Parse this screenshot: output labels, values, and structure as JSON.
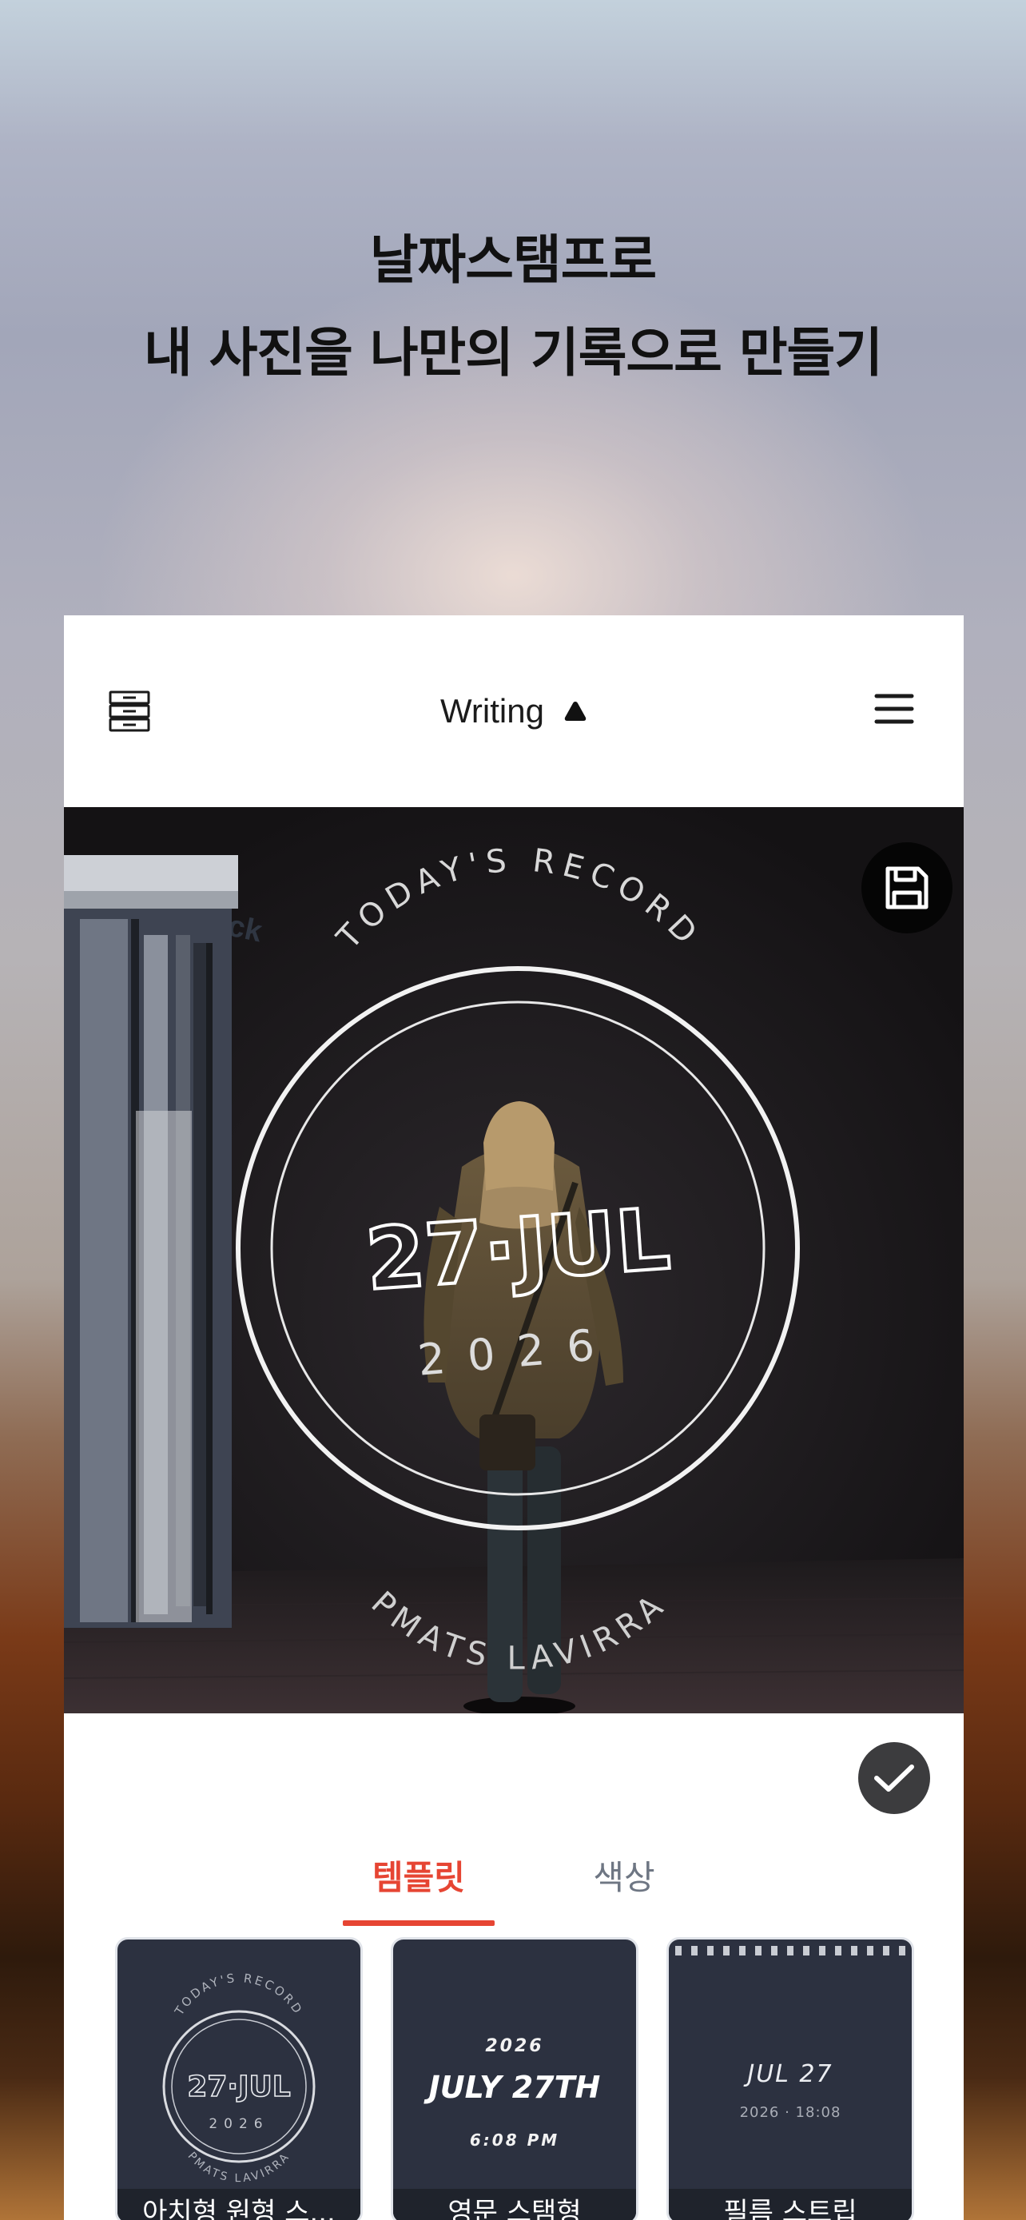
{
  "headline": {
    "line1": "날짜스탬프로",
    "line2": "내 사진을 나만의 기록으로 만들기"
  },
  "app_bar": {
    "left_icon": "drawer-stack-icon",
    "title": "Writing",
    "title_icon": "triangle-up-icon",
    "right_icon": "hamburger-menu-icon"
  },
  "photo": {
    "storefront_sign": "Neck",
    "stamp": {
      "top_text": "TODAY'S RECORD",
      "date": "27·JUL",
      "year": "2026",
      "bottom_text": "PMATS LAVIRRA"
    },
    "save_icon": "floppy-disk-icon"
  },
  "confirm_icon": "checkmark-icon",
  "tabs": [
    {
      "label": "템플릿",
      "active": true
    },
    {
      "label": "색상",
      "active": false
    }
  ],
  "templates": [
    {
      "label": "아치형 원형 스...",
      "top_text": "TODAY'S RECORD",
      "date": "27·JUL",
      "year": "2026",
      "bottom_text": "PMATS LAVIRRA"
    },
    {
      "label": "영문 스탬형",
      "year": "2026",
      "date": "JULY 27TH",
      "time": "6:08 PM"
    },
    {
      "label": "필름 스트립",
      "date": "JUL 27",
      "sub": "2026 · 18:08"
    }
  ],
  "colors": {
    "accent": "#e64533",
    "card_bg": "#2c3140",
    "tab_inactive": "#6e7683"
  }
}
